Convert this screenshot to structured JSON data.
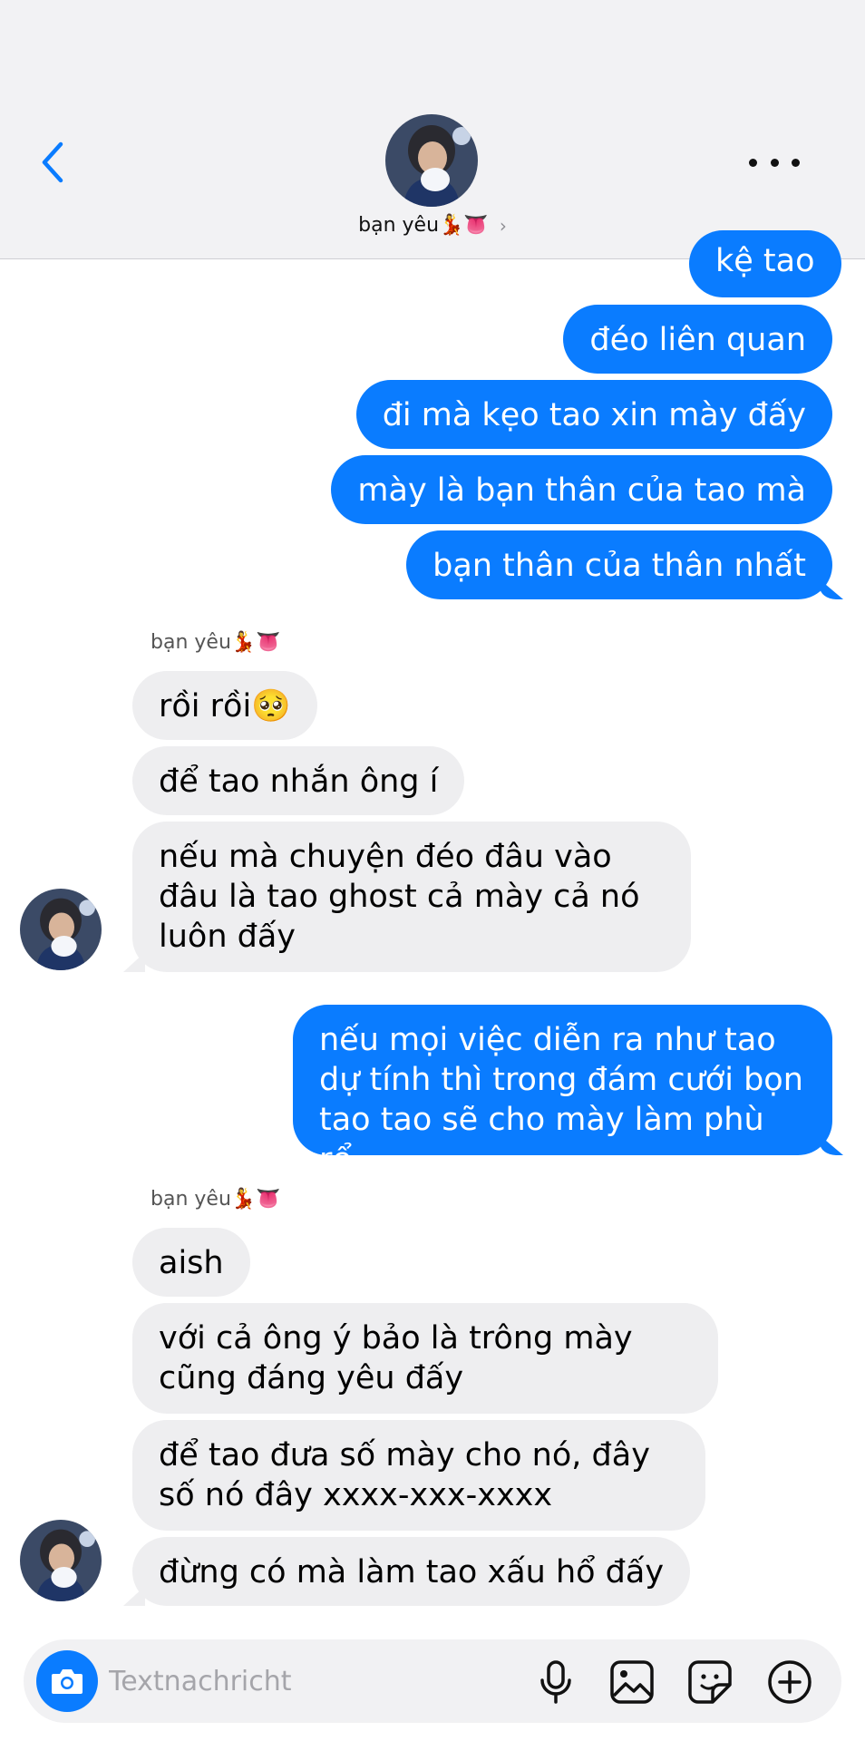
{
  "header": {
    "contact_name": "bạn yêu💃👅",
    "chevron": "›"
  },
  "messages": [
    {
      "dir": "out",
      "text": "kệ tao"
    },
    {
      "dir": "out",
      "text": "đéo liên quan"
    },
    {
      "dir": "out",
      "text": "đi mà kẹo tao xin mày đấy"
    },
    {
      "dir": "out",
      "text": "mày là bạn thân của tao mà"
    },
    {
      "dir": "out",
      "text": "bạn thân của thân nhất"
    },
    {
      "dir": "label",
      "text": "bạn yêu💃👅"
    },
    {
      "dir": "in",
      "text": "rồi rồi🥺"
    },
    {
      "dir": "in",
      "text": "để tao nhắn ông í"
    },
    {
      "dir": "in",
      "text": "nếu mà chuyện đéo đâu vào đâu là tao ghost cả mày cả nó luôn đấy"
    },
    {
      "dir": "out",
      "text": "nếu mọi việc diễn ra như tao dự tính thì trong đám cưới bọn tao tao sẽ cho mày làm phù rể"
    },
    {
      "dir": "label",
      "text": "bạn yêu💃👅"
    },
    {
      "dir": "in",
      "text": "aish"
    },
    {
      "dir": "in",
      "text": "với cả ông ý bảo là trông mày cũng đáng yêu đấy"
    },
    {
      "dir": "in",
      "text": "để tao đưa số mày cho nó, đây số nó đây xxxx-xxx-xxxx"
    },
    {
      "dir": "in",
      "text": "đừng có mà làm tao xấu hổ đấy"
    }
  ],
  "composer": {
    "placeholder": "Textnachricht",
    "value": ""
  },
  "icons": {
    "back": "chevron-left-icon",
    "more": "more-dots-icon",
    "camera": "camera-icon",
    "mic": "microphone-icon",
    "gallery": "image-icon",
    "sticker": "sticker-icon",
    "add": "plus-circle-icon"
  },
  "colors": {
    "accent": "#0a7cff",
    "incoming_bubble": "#eeeef0",
    "header_bg": "#f2f2f4"
  }
}
